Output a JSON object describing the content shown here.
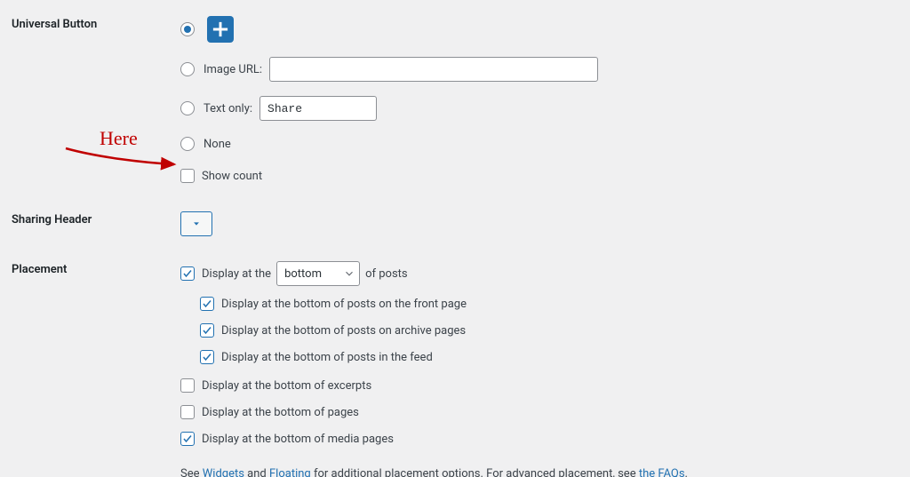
{
  "universalButton": {
    "label": "Universal Button",
    "imageUrlLabel": "Image URL:",
    "imageUrlValue": "",
    "textOnlyLabel": "Text only:",
    "textOnlyValue": "Share",
    "noneLabel": "None",
    "showCountLabel": "Show count"
  },
  "sharingHeader": {
    "label": "Sharing Header"
  },
  "placement": {
    "label": "Placement",
    "displayAtThe": "Display at the",
    "positionSelected": "bottom",
    "ofPosts": "of posts",
    "frontPage": "Display at the bottom of posts on the front page",
    "archivePages": "Display at the bottom of posts on archive pages",
    "inFeed": "Display at the bottom of posts in the feed",
    "excerpts": "Display at the bottom of excerpts",
    "pages": "Display at the bottom of pages",
    "mediaPages": "Display at the bottom of media pages",
    "footerSee": "See",
    "footerWidgets": "Widgets",
    "footerAnd": "and",
    "footerFloating": "Floating",
    "footerMid": "for additional placement options. For advanced placement, see",
    "footerFaqs": "the FAQs",
    "footerDot": "."
  },
  "annotation": {
    "text": "Here"
  }
}
